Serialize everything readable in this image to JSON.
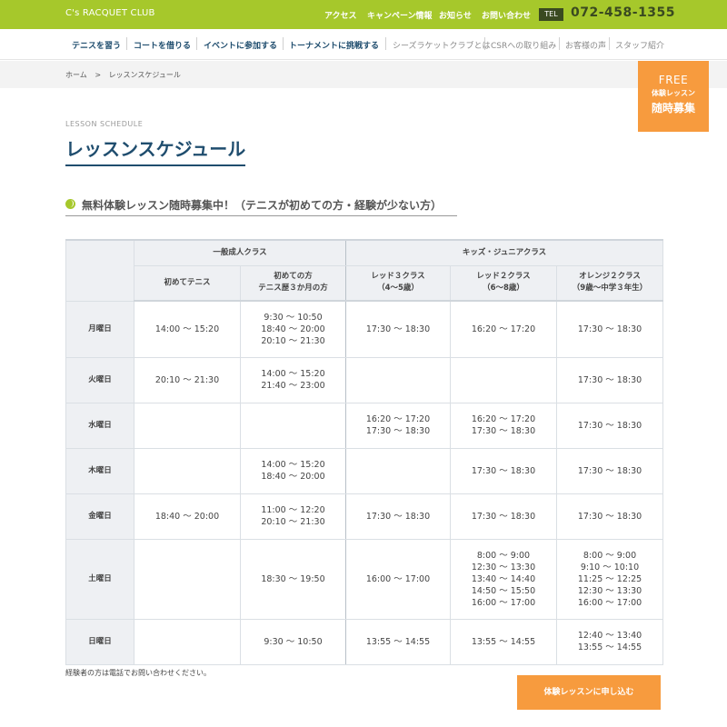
{
  "header": {
    "logo": "C's RACQUET CLUB",
    "nav": [
      "アクセス",
      "キャンペーン情報",
      "お知らせ",
      "お問い合わせ"
    ],
    "tel_label": "TEL",
    "tel_number": "072-458-1355"
  },
  "main_nav": {
    "primary": [
      "テニスを習う",
      "コートを借りる",
      "イベントに参加する",
      "トーナメントに挑戦する"
    ],
    "secondary": [
      "シーズラケットクラブとは",
      "CSRへの取り組み",
      "お客様の声",
      "スタッフ紹介"
    ]
  },
  "breadcrumb": {
    "home": "ホーム",
    "separator": ">",
    "current": "レッスンスケジュール"
  },
  "free_badge": {
    "line1": "FREE",
    "line2": "体験レッスン",
    "line3": "随時募集"
  },
  "section": {
    "en_title": "LESSON SCHEDULE",
    "title": "レッスンスケジュール",
    "subheading": "無料体験レッスン随時募集中！（テニスが初めての方・経験が少ない方）"
  },
  "table": {
    "groups": [
      "一般成人クラス",
      "キッズ・ジュニアクラス"
    ],
    "columns": [
      [
        "初めてテニス"
      ],
      [
        "初めての方",
        "テニス歴３か月の方"
      ],
      [
        "レッド３クラス",
        "（4〜5歳）"
      ],
      [
        "レッド２クラス",
        "（6〜8歳）"
      ],
      [
        "オレンジ２クラス",
        "（9歳〜中学３年生）"
      ]
    ],
    "rows": [
      {
        "day": "月曜日",
        "cells": [
          [
            "14:00 〜 15:20"
          ],
          [
            "9:30 〜 10:50",
            "18:40 〜 20:00",
            "20:10 〜 21:30"
          ],
          [
            "17:30 〜 18:30"
          ],
          [
            "16:20 〜 17:20"
          ],
          [
            "17:30 〜 18:30"
          ]
        ]
      },
      {
        "day": "火曜日",
        "cells": [
          [
            "20:10 〜 21:30"
          ],
          [
            "14:00 〜 15:20",
            "21:40 〜 23:00"
          ],
          [],
          [],
          [
            "17:30 〜 18:30"
          ]
        ]
      },
      {
        "day": "水曜日",
        "cells": [
          [],
          [],
          [
            "16:20 〜 17:20",
            "17:30 〜 18:30"
          ],
          [
            "16:20 〜 17:20",
            "17:30 〜 18:30"
          ],
          [
            "17:30 〜 18:30"
          ]
        ]
      },
      {
        "day": "木曜日",
        "cells": [
          [],
          [
            "14:00 〜 15:20",
            "18:40 〜 20:00"
          ],
          [],
          [
            "17:30 〜 18:30"
          ],
          [
            "17:30 〜 18:30"
          ]
        ]
      },
      {
        "day": "金曜日",
        "cells": [
          [
            "18:40 〜 20:00"
          ],
          [
            "11:00 〜 12:20",
            "20:10 〜 21:30"
          ],
          [
            "17:30 〜 18:30"
          ],
          [
            "17:30 〜 18:30"
          ],
          [
            "17:30 〜 18:30"
          ]
        ]
      },
      {
        "day": "土曜日",
        "cells": [
          [],
          [
            "18:30 〜 19:50"
          ],
          [
            "16:00 〜 17:00"
          ],
          [
            "8:00 〜 9:00",
            "12:30 〜 13:30",
            "13:40 〜 14:40",
            "14:50 〜 15:50",
            "16:00 〜 17:00"
          ],
          [
            "8:00 〜 9:00",
            "9:10 〜 10:10",
            "11:25 〜 12:25",
            "12:30 〜 13:30",
            "16:00 〜 17:00"
          ]
        ]
      },
      {
        "day": "日曜日",
        "cells": [
          [],
          [
            "9:30 〜 10:50"
          ],
          [
            "13:55 〜 14:55"
          ],
          [
            "13:55 〜 14:55"
          ],
          [
            "12:40 〜 13:40",
            "13:55 〜 14:55"
          ]
        ]
      }
    ]
  },
  "note": "経験者の方は電話でお問い合わせください。",
  "apply_button": "体験レッスンに申し込む",
  "colors": {
    "brand_green": "#a6c82b",
    "accent_orange": "#f79b3e",
    "navy": "#1f4d6e"
  }
}
